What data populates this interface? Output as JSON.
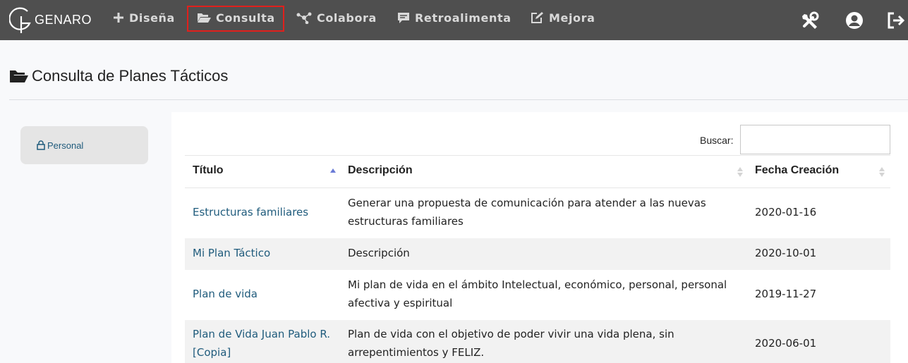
{
  "nav": {
    "brand": "GENARO",
    "items": [
      {
        "label": "Diseña"
      },
      {
        "label": "Consulta"
      },
      {
        "label": "Colabora"
      },
      {
        "label": "Retroalimenta"
      },
      {
        "label": "Mejora"
      }
    ],
    "icons": [
      "tools-icon",
      "user-circle-icon",
      "logout-icon"
    ]
  },
  "page": {
    "title": "Consulta de Planes Tácticos"
  },
  "sidebar": {
    "items": [
      {
        "label": "Personal",
        "icon": "lock-icon"
      }
    ]
  },
  "search": {
    "label": "Buscar:",
    "value": ""
  },
  "table": {
    "columns": [
      "Título",
      "Descripción",
      "Fecha Creación"
    ],
    "rows": [
      {
        "title": "Estructuras familiares",
        "desc1": "Generar una propuesta de comunicación para atender a las nuevas",
        "desc2": "estructuras familiares",
        "date": "2020-01-16"
      },
      {
        "title": "Mi Plan Táctico",
        "desc1": "Descripción",
        "desc2": "",
        "date": "2020-10-01"
      },
      {
        "title": "Plan de vida",
        "desc1": "Mi plan de vida en el ámbito Intelectual, económico, personal, personal",
        "desc2": "afectiva y espiritual",
        "date": "2019-11-27"
      },
      {
        "title1": "Plan de Vida Juan Pablo R.",
        "title2": "[Copia]",
        "desc1": "Plan de vida con el objetivo de poder vivir una vida plena, sin",
        "desc2": "arrepentimientos y FELIZ.",
        "date": "2020-06-01"
      }
    ]
  },
  "colors": {
    "navbar": "#4f4f4f",
    "nav_text": "#d9d9d9",
    "active_outline": "#e0201c",
    "link": "#1f5b7c"
  }
}
